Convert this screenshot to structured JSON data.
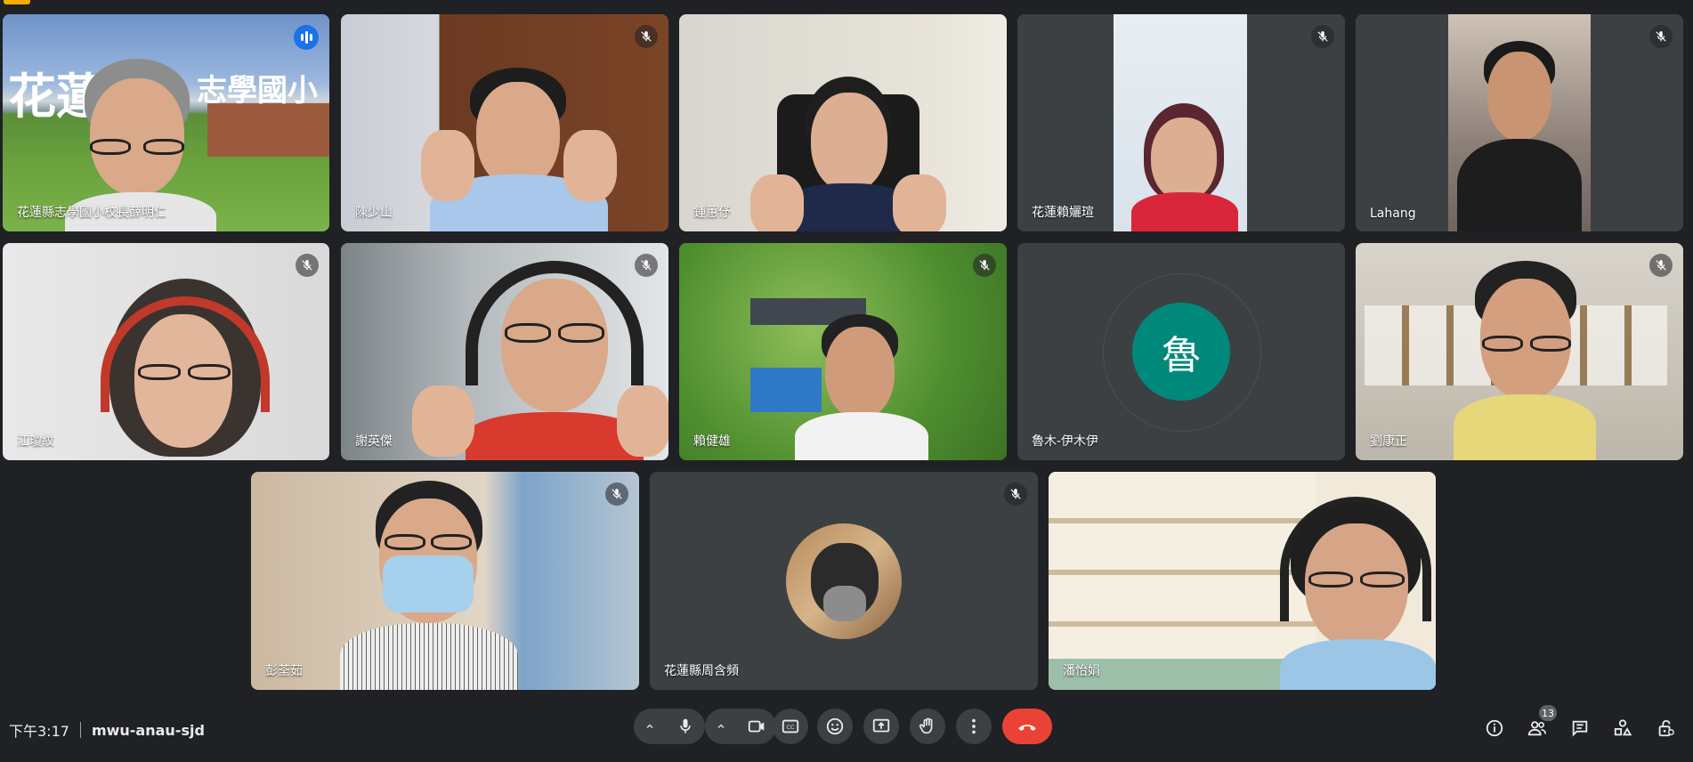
{
  "meeting": {
    "time": "下午3:17",
    "code": "mwu-anau-sjd",
    "participant_count": "13"
  },
  "participants": [
    {
      "name": "花蓮縣志學國小校長薛明仁",
      "speaking": true,
      "background_text_1": "花蓮",
      "background_text_2": "志學國小"
    },
    {
      "name": "陳少山",
      "muted": true
    },
    {
      "name": "鍾蕙伃",
      "muted": true
    },
    {
      "name": "花蓮賴孋瑄",
      "muted": true
    },
    {
      "name": "Lahang",
      "muted": true
    },
    {
      "name": "江瓊紋",
      "muted": true
    },
    {
      "name": "謝英傑",
      "muted": true
    },
    {
      "name": "賴健雄",
      "muted": true
    },
    {
      "name": "魯木-伊木伊",
      "muted": true,
      "avatar_letter": "魯"
    },
    {
      "name": "劉康正",
      "muted": true
    },
    {
      "name": "彭荃茹",
      "muted": true
    },
    {
      "name": "花蓮縣周含頻",
      "muted": true
    },
    {
      "name": "潘怡娟",
      "muted": false
    }
  ],
  "colors": {
    "background": "#202124",
    "tile": "#3c4043",
    "active_border": "#8ab4f8",
    "hangup": "#ea4335",
    "avatar": "#00897b"
  },
  "controls": [
    "mic-options-chevron",
    "mic-icon",
    "camera-options-chevron",
    "camera-icon",
    "captions-icon",
    "emoji-icon",
    "present-screen-icon",
    "raise-hand-icon",
    "more-options-icon",
    "hang-up-icon"
  ],
  "right_controls": [
    "info-icon",
    "people-icon",
    "chat-icon",
    "activities-icon",
    "host-controls-icon"
  ]
}
